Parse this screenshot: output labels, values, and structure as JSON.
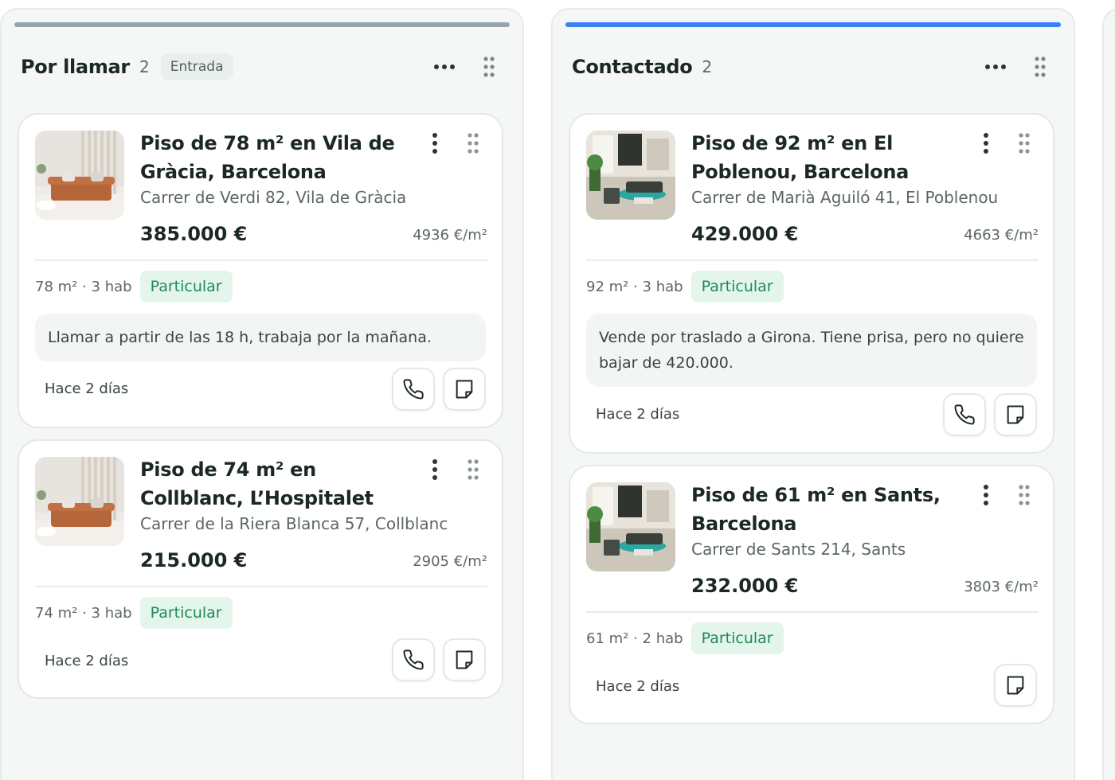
{
  "columns": [
    {
      "title": "Por llamar",
      "count": "2",
      "badge": "Entrada",
      "bar_color": "#97a3ad",
      "cards": [
        {
          "title": "Piso de 78 m² en Vila de Gràcia, Barcelona",
          "address": "Carrer de Verdi 82, Vila de Gràcia",
          "price": "385.000 €",
          "price_per_m2": "4936 €/m²",
          "specs": "78 m² · 3 hab",
          "tag": "Particular",
          "note": "Llamar a partir de las 18 h, trabaja por la mañana.",
          "time": "Hace 2 días"
        },
        {
          "title": "Piso de 74 m² en Collblanc, L’Hospitalet",
          "address": "Carrer de la Riera Blanca 57, Collblanc",
          "price": "215.000 €",
          "price_per_m2": "2905 €/m²",
          "specs": "74 m² · 3 hab",
          "tag": "Particular",
          "time": "Hace 2 días"
        }
      ]
    },
    {
      "title": "Contactado",
      "count": "2",
      "bar_color": "#3b82f6",
      "cards": [
        {
          "title": "Piso de 92 m² en El Poblenou, Barcelona",
          "address": "Carrer de Marià Aguiló 41, El Poblenou",
          "price": "429.000 €",
          "price_per_m2": "4663 €/m²",
          "specs": "92 m² · 3 hab",
          "tag": "Particular",
          "note": "Vende por traslado a Girona. Tiene prisa, pero no quiere bajar de 420.000.",
          "time": "Hace 2 días"
        },
        {
          "title": "Piso de 61 m² en Sants, Barcelona",
          "address": "Carrer de Sants 214, Sants",
          "price": "232.000 €",
          "price_per_m2": "3803 €/m²",
          "specs": "61 m² · 2 hab",
          "tag": "Particular",
          "time": "Hace 2 días"
        }
      ]
    }
  ],
  "icons": {
    "more": "more-horizontal-icon",
    "grip": "drag-handle-icon",
    "kebab": "more-vertical-icon",
    "phone": "phone-icon",
    "note": "note-icon"
  },
  "colors": {
    "tag_bg": "#e4f5ec",
    "tag_text": "#1e8a55"
  }
}
